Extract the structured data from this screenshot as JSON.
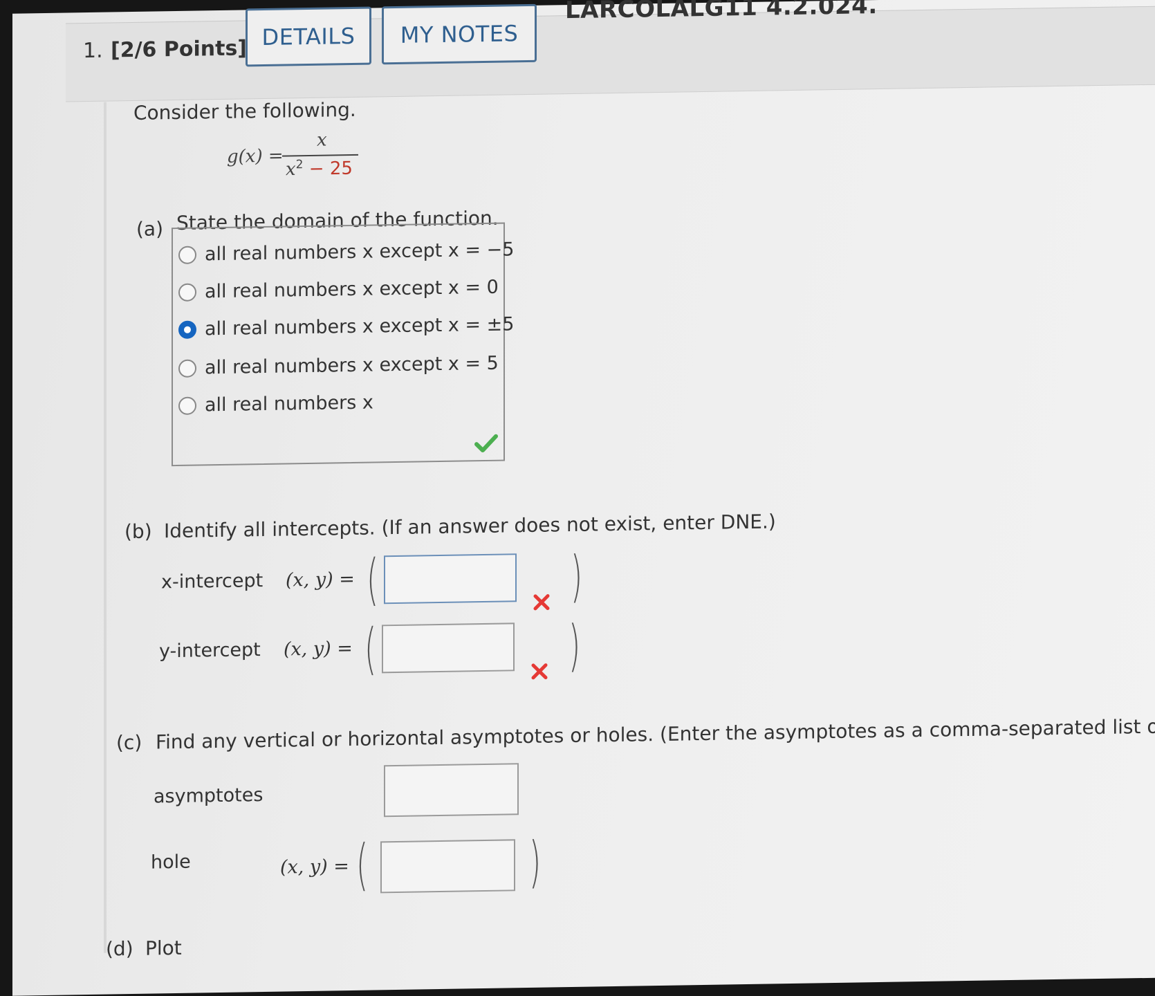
{
  "header": {
    "question_number": "1.",
    "points": "[2/6 Points]",
    "details_label": "DETAILS",
    "my_notes_label": "MY NOTES",
    "question_id": "LARCOLALG11 4.2.024."
  },
  "intro": "Consider the following.",
  "function": {
    "lhs": "g(x) =",
    "numerator": "x",
    "denominator_base": "x",
    "denominator_exp": "2",
    "denominator_rest": "− 25"
  },
  "part_a": {
    "label": "(a)",
    "prompt": "State the domain of the function.",
    "choices": [
      "all real numbers x except x = −5",
      "all real numbers x except x = 0",
      "all real numbers x except x = ±5",
      "all real numbers x except x = 5",
      "all real numbers x"
    ],
    "selected_index": 2,
    "status": "correct"
  },
  "part_b": {
    "label": "(b)",
    "prompt": "Identify all intercepts. (If an answer does not exist, enter DNE.)",
    "x_intercept_label": "x-intercept",
    "y_intercept_label": "y-intercept",
    "coord_label": "(x, y) =",
    "x_intercept_value": "",
    "y_intercept_value": "",
    "x_status": "incorrect",
    "y_status": "incorrect"
  },
  "part_c": {
    "label": "(c)",
    "prompt": "Find any vertical or horizontal asymptotes or holes. (Enter the asymptotes as a comma-separated list of",
    "asymptotes_label": "asymptotes",
    "hole_label": "hole",
    "coord_label": "(x, y) =",
    "asymptotes_value": "",
    "hole_value": ""
  },
  "part_d": {
    "label": "(d)",
    "prompt_fragment": "Plot"
  },
  "colors": {
    "accent": "#1565c0",
    "button_text": "#2f5f8f",
    "correct": "#4caf50",
    "incorrect": "#e53935"
  }
}
